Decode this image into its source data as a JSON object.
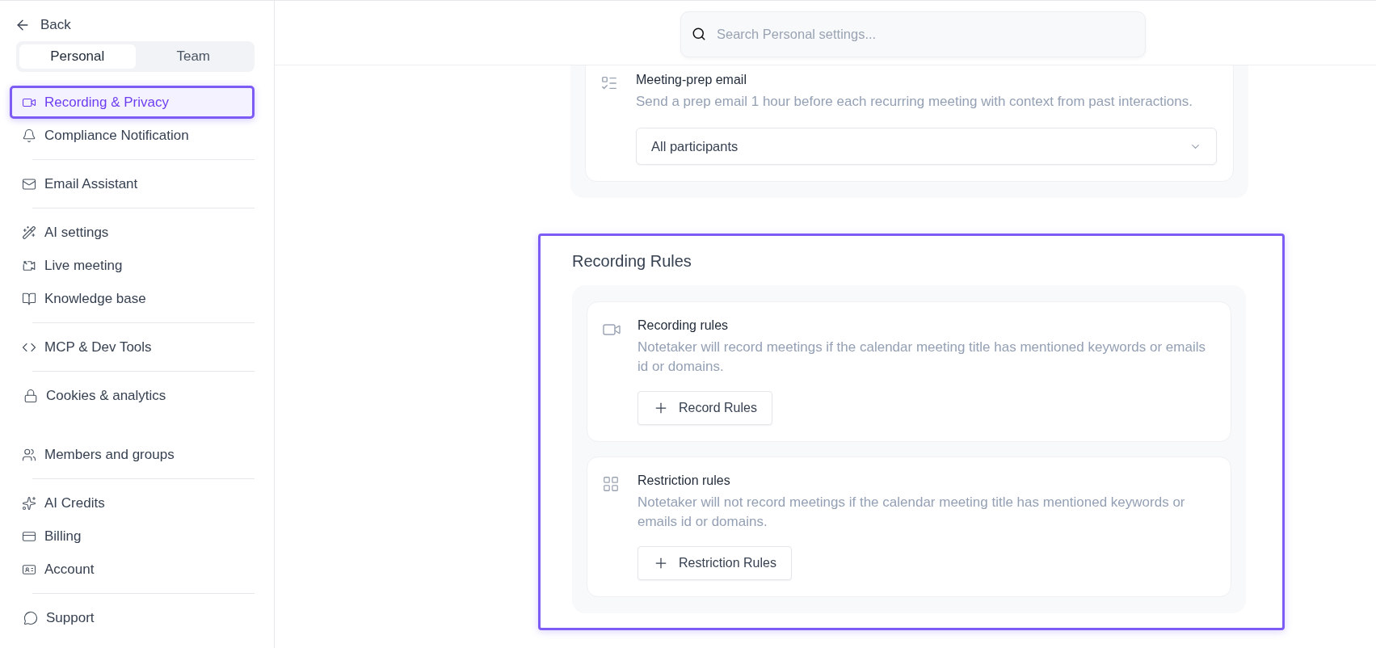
{
  "sidebar": {
    "back": "Back",
    "tabs": [
      {
        "label": "Personal",
        "selected": true
      },
      {
        "label": "Team",
        "selected": false
      }
    ],
    "groups": [
      {
        "divider": true,
        "items": [
          {
            "label": "Recording & Privacy",
            "selected": true
          },
          {
            "label": "Compliance Notification",
            "selected": false
          }
        ]
      },
      {
        "divider": true,
        "items": [
          {
            "label": "Email Assistant",
            "selected": false
          }
        ]
      },
      {
        "divider": true,
        "items": [
          {
            "label": "AI settings",
            "selected": false
          },
          {
            "label": "Live meeting",
            "selected": false
          },
          {
            "label": "Knowledge base",
            "selected": false
          }
        ]
      },
      {
        "divider": true,
        "items": [
          {
            "label": "MCP & Dev Tools",
            "selected": false
          }
        ]
      },
      {
        "divider": false,
        "items": [
          {
            "label": "Cookies & analytics",
            "selected": false
          }
        ]
      },
      {
        "divider": true,
        "items": [
          {
            "label": "Members and groups",
            "selected": false
          }
        ]
      },
      {
        "divider": true,
        "items": [
          {
            "label": "AI Credits",
            "selected": false
          },
          {
            "label": "Billing",
            "selected": false
          },
          {
            "label": "Account",
            "selected": false
          }
        ]
      },
      {
        "divider": false,
        "items": [
          {
            "label": "Support",
            "selected": false
          }
        ]
      }
    ]
  },
  "search": {
    "placeholder": "Search Personal settings..."
  },
  "meeting_prep": {
    "title": "Meeting-prep email",
    "description": "Send a prep email 1 hour before each recurring meeting with context from past interactions.",
    "select": {
      "value": "All participants"
    }
  },
  "recording_rules": {
    "title": "Recording Rules",
    "highlighted": true,
    "rules": [
      {
        "title": "Recording rules",
        "description": "Notetaker will record meetings if the calendar meeting title has mentioned keywords or emails id or domains.",
        "button": "Record Rules"
      },
      {
        "title": "Restriction rules",
        "description": "Notetaker will not record meetings if the calendar meeting title has mentioned keywords or emails id or domains.",
        "button": "Restriction Rules"
      }
    ]
  }
}
